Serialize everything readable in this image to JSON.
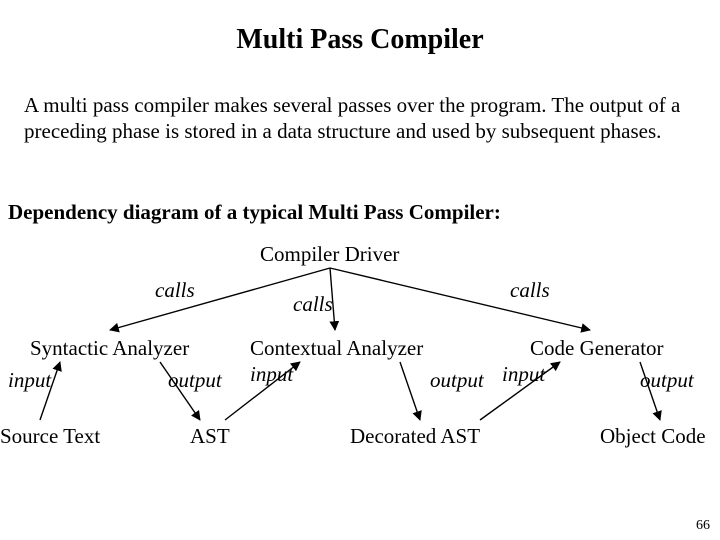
{
  "title": "Multi Pass Compiler",
  "paragraph": "A multi pass compiler makes several passes over the program. The output of a preceding phase is stored in a data structure and used by subsequent phases.",
  "subheading": "Dependency diagram of a typical Multi Pass Compiler:",
  "diagram": {
    "driver": "Compiler Driver",
    "calls_left": "calls",
    "calls_center": "calls",
    "calls_right": "calls",
    "phase1": "Syntactic Analyzer",
    "phase2": "Contextual Analyzer",
    "phase3": "Code Generator",
    "io": {
      "input": "input",
      "output": "output"
    },
    "artifact1": "Source Text",
    "artifact2": "AST",
    "artifact3": "Decorated AST",
    "artifact4": "Object Code"
  },
  "page_number": "66"
}
